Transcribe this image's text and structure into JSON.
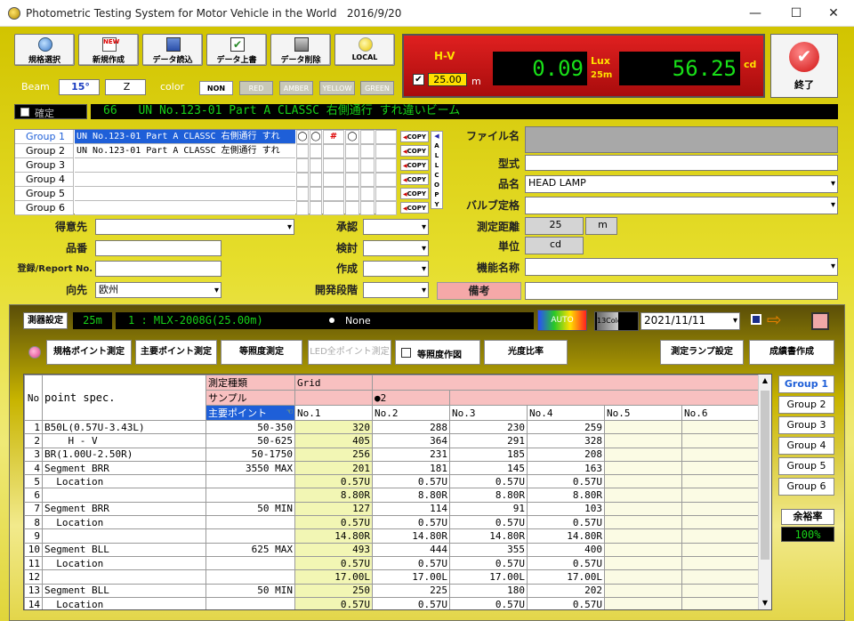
{
  "app": {
    "title": "Photometric Testing System for Motor Vehicle in the World",
    "date": "2016/9/20",
    "minimize": "—",
    "maximize": "☐",
    "close": "✕"
  },
  "toolbar": {
    "buttons": [
      {
        "label": "規格選択",
        "icon": "circle-icon"
      },
      {
        "label": "新規作成",
        "icon": "new-icon"
      },
      {
        "label": "データ読込",
        "icon": "load-icon"
      },
      {
        "label": "データ上書",
        "icon": "overwrite-icon"
      },
      {
        "label": "データ削除",
        "icon": "delete-icon"
      },
      {
        "label": "LOCAL",
        "icon": "lamp-icon"
      }
    ]
  },
  "meter": {
    "hv_label": "H-V",
    "lux": "0.09",
    "lux_unit": "Lux",
    "dist_unit": "25m",
    "cd": "56.25",
    "cd_unit": "cd",
    "distance": "25.00",
    "m_unit": "m",
    "accent": "#cc1010"
  },
  "exit_label": "終了",
  "beam": {
    "label": "Beam",
    "angle": "15°",
    "axis": "Z",
    "color_label": "color",
    "colors": [
      "NON",
      "RED",
      "AMBER",
      "YELLOW",
      "GREEN"
    ]
  },
  "confirm": {
    "label": "確定",
    "number": "66",
    "title": "UN No.123-01 Part A CLASSC 右側通行 すれ違いビーム"
  },
  "groups": [
    {
      "label": "Group 1",
      "text": "UN No.123-01 Part A CLASSC 右側通行 すれ",
      "m1": "◯",
      "m2": "◯",
      "m3": "#",
      "m4": "◯"
    },
    {
      "label": "Group 2",
      "text": "UN No.123-01 Part A CLASSC 左側通行 すれ",
      "m1": "",
      "m2": "",
      "m3": "",
      "m4": ""
    },
    {
      "label": "Group 3",
      "text": "",
      "m1": "",
      "m2": "",
      "m3": "",
      "m4": ""
    },
    {
      "label": "Group 4",
      "text": "",
      "m1": "",
      "m2": "",
      "m3": "",
      "m4": ""
    },
    {
      "label": "Group 5",
      "text": "",
      "m1": "",
      "m2": "",
      "m3": "",
      "m4": ""
    },
    {
      "label": "Group 6",
      "text": "",
      "m1": "",
      "m2": "",
      "m3": "",
      "m4": ""
    }
  ],
  "copy_label": "COPY",
  "allcopy": [
    "A",
    "L",
    "L",
    "C",
    "O",
    "P",
    "Y"
  ],
  "info": {
    "file_label": "ファイル名",
    "file": "",
    "model_label": "型式",
    "model": "",
    "item_label": "品名",
    "item": "HEAD LAMP",
    "bulb_label": "バルブ定格",
    "bulb": "",
    "dist_label": "測定距離",
    "dist": "25",
    "dist_unit": "m",
    "unit_label": "単位",
    "unit": "cd",
    "func_label": "機能名称",
    "func": "",
    "note_label": "備考",
    "note": ""
  },
  "left": {
    "customer_label": "得意先",
    "customer": "",
    "part_label": "品番",
    "part": "",
    "reg_label": "登録/Report No.",
    "reg": "",
    "dest_label": "向先",
    "dest": "欧州",
    "approve_label": "承認",
    "approve": "",
    "review_label": "検討",
    "review": "",
    "make_label": "作成",
    "make": "",
    "stage_label": "開発段階",
    "stage": ""
  },
  "meas": {
    "label": "測器設定",
    "dist": "25m",
    "device": "1 : MLX-2008G(25.00m)",
    "none": "None",
    "auto": "AUTO",
    "color_btn": "13Colo",
    "date": "2021/11/11"
  },
  "actions": [
    "規格ポイント測定",
    "主要ポイント測定",
    "等照度測定",
    "LED全ポイント測定",
    "等照度作図",
    "光度比率",
    "測定ランプ設定",
    "成績書作成"
  ],
  "right_groups": [
    "Group 1",
    "Group 2",
    "Group 3",
    "Group 4",
    "Group 5",
    "Group 6"
  ],
  "margin": {
    "label": "余裕率",
    "value": "100%"
  },
  "table": {
    "no_header": "No",
    "spec_header": "point spec.",
    "type_label": "測定種類",
    "type_value": "Grid",
    "sample_label": "サンプル",
    "sample_value": "●2",
    "main_label": "主要ポイント",
    "cols": [
      "No.1",
      "No.2",
      "No.3",
      "No.4",
      "No.5",
      "No.6"
    ],
    "rows": [
      {
        "no": "1",
        "name": "B50L(0.57U-3.43L)",
        "spec": "50-350",
        "v": [
          "320",
          "288",
          "230",
          "259",
          "",
          ""
        ]
      },
      {
        "no": "2",
        "name": "    H - V",
        "spec": "50-625",
        "v": [
          "405",
          "364",
          "291",
          "328",
          "",
          ""
        ]
      },
      {
        "no": "3",
        "name": "BR(1.00U-2.50R)",
        "spec": "50-1750",
        "v": [
          "256",
          "231",
          "185",
          "208",
          "",
          ""
        ]
      },
      {
        "no": "4",
        "name": "Segment BRR",
        "spec": "3550 MAX",
        "v": [
          "201",
          "181",
          "145",
          "163",
          "",
          ""
        ]
      },
      {
        "no": "5",
        "name": "  Location",
        "spec": "",
        "v": [
          "0.57U",
          "0.57U",
          "0.57U",
          "0.57U",
          "",
          ""
        ]
      },
      {
        "no": "6",
        "name": "",
        "spec": "",
        "v": [
          "8.80R",
          "8.80R",
          "8.80R",
          "8.80R",
          "",
          ""
        ]
      },
      {
        "no": "7",
        "name": "Segment BRR",
        "spec": "50 MIN",
        "v": [
          "127",
          "114",
          "91",
          "103",
          "",
          ""
        ]
      },
      {
        "no": "8",
        "name": "  Location",
        "spec": "",
        "v": [
          "0.57U",
          "0.57U",
          "0.57U",
          "0.57U",
          "",
          ""
        ]
      },
      {
        "no": "9",
        "name": "",
        "spec": "",
        "v": [
          "14.80R",
          "14.80R",
          "14.80R",
          "14.80R",
          "",
          ""
        ]
      },
      {
        "no": "10",
        "name": "Segment BLL",
        "spec": "625 MAX",
        "v": [
          "493",
          "444",
          "355",
          "400",
          "",
          ""
        ]
      },
      {
        "no": "11",
        "name": "  Location",
        "spec": "",
        "v": [
          "0.57U",
          "0.57U",
          "0.57U",
          "0.57U",
          "",
          ""
        ]
      },
      {
        "no": "12",
        "name": "",
        "spec": "",
        "v": [
          "17.00L",
          "17.00L",
          "17.00L",
          "17.00L",
          "",
          ""
        ]
      },
      {
        "no": "13",
        "name": "Segment BLL",
        "spec": "50 MIN",
        "v": [
          "250",
          "225",
          "180",
          "202",
          "",
          ""
        ]
      },
      {
        "no": "14",
        "name": "  Location",
        "spec": "",
        "v": [
          "0.57U",
          "0.57U",
          "0.57U",
          "0.57U",
          "",
          ""
        ]
      }
    ]
  }
}
